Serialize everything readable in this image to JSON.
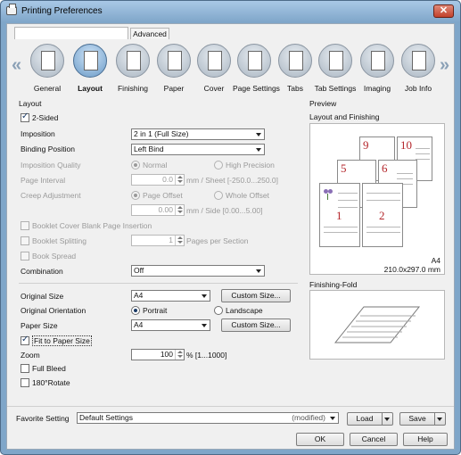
{
  "window": {
    "title": "Printing Preferences",
    "close_label": "✕"
  },
  "tabs": {
    "blank": "",
    "advanced": "Advanced"
  },
  "categories": [
    {
      "label": "Layout",
      "icon": "layout-icon",
      "selected": true
    },
    {
      "label": "General",
      "icon": "general-icon",
      "selected": false
    },
    {
      "label": "Finishing",
      "icon": "finishing-icon",
      "selected": false
    },
    {
      "label": "Paper",
      "icon": "paper-icon",
      "selected": false
    },
    {
      "label": "Cover",
      "icon": "cover-icon",
      "selected": false
    },
    {
      "label": "Page Settings",
      "icon": "page-settings-icon",
      "selected": false
    },
    {
      "label": "Tabs",
      "icon": "tabs-icon",
      "selected": false
    },
    {
      "label": "Tab Settings",
      "icon": "tab-settings-icon",
      "selected": false
    },
    {
      "label": "Imaging",
      "icon": "imaging-icon",
      "selected": false
    },
    {
      "label": "Job Info",
      "icon": "job-info-icon",
      "selected": false
    }
  ],
  "layout": {
    "group_title": "Layout",
    "two_sided": "2-Sided",
    "imposition_label": "Imposition",
    "imposition_value": "2 in 1 (Full Size)",
    "binding_label": "Binding Position",
    "binding_value": "Left Bind",
    "quality_label": "Imposition Quality",
    "quality_normal": "Normal",
    "quality_high": "High Precision",
    "page_interval_label": "Page Interval",
    "page_interval_value": "0.0",
    "page_interval_unit": "mm / Sheet [-250.0...250.0]",
    "creep_label": "Creep Adjustment",
    "creep_page_offset": "Page Offset",
    "creep_whole_offset": "Whole Offset",
    "creep_value": "0.00",
    "creep_unit": "mm / Side [0.00...5.00]",
    "booklet_cover": "Booklet Cover Blank Page Insertion",
    "booklet_splitting": "Booklet Splitting",
    "booklet_splitting_value": "1",
    "booklet_splitting_unit": "Pages per Section",
    "book_spread": "Book Spread",
    "combination_label": "Combination",
    "combination_value": "Off",
    "original_size_label": "Original Size",
    "original_size_value": "A4",
    "custom_size_1": "Custom Size...",
    "orientation_label": "Original Orientation",
    "orientation_portrait": "Portrait",
    "orientation_landscape": "Landscape",
    "paper_size_label": "Paper Size",
    "paper_size_value": "A4",
    "custom_size_2": "Custom Size...",
    "fit_to_paper": "Fit to Paper Size",
    "zoom_label": "Zoom",
    "zoom_value": "100",
    "zoom_unit": "% [1...1000]",
    "full_bleed": "Full Bleed",
    "rotate_180": "180°Rotate"
  },
  "preview": {
    "group_title": "Preview",
    "layout_finishing_label": "Layout and Finishing",
    "page_numbers": [
      "9",
      "10",
      "5",
      "6",
      "1",
      "2"
    ],
    "paper_name": "A4",
    "paper_dims": "210.0x297.0 mm",
    "finishing_fold_label": "Finishing-Fold"
  },
  "bottom": {
    "favorite_label": "Favorite Setting",
    "favorite_value": "Default Settings",
    "favorite_status": "(modified)",
    "load": "Load",
    "save": "Save",
    "ok": "OK",
    "cancel": "Cancel",
    "help": "Help"
  },
  "state": {
    "two_sided_checked": true,
    "fit_to_paper_checked": true,
    "orientation": "Portrait",
    "quality": "Normal",
    "creep_mode": "Page Offset"
  }
}
